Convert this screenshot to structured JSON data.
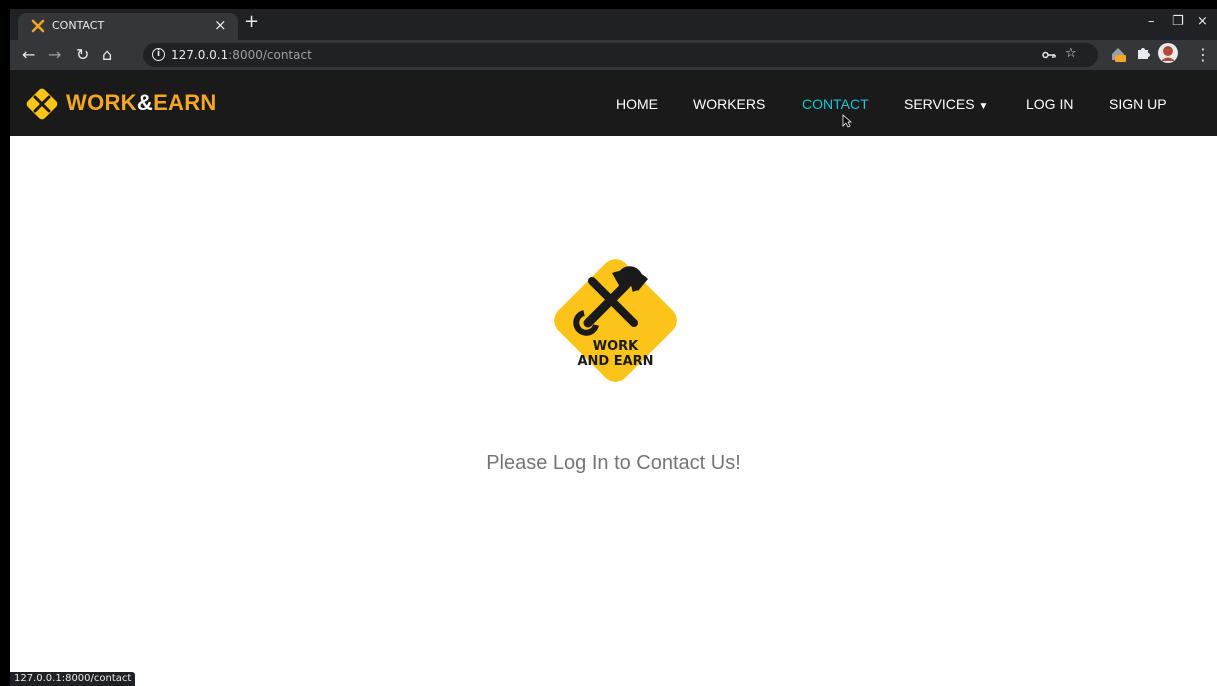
{
  "browser": {
    "tab": {
      "title": "CONTACT",
      "close": "×"
    },
    "new_tab": "+",
    "window_controls": {
      "minimize": "–",
      "restore": "❐",
      "close": "×"
    },
    "address_bar": {
      "host": "127.0.0.1",
      "path": ":8000/contact"
    },
    "status_url": "127.0.0.1:8000/contact",
    "icons": [
      "back-icon",
      "forward-icon",
      "reload-icon",
      "home-icon",
      "info-icon",
      "key-icon",
      "star-icon",
      "extension-off-icon",
      "puzzle-icon",
      "profile-avatar",
      "more-menu-icon"
    ]
  },
  "site": {
    "brand": {
      "work": "WORK",
      "amp": "&",
      "earn": "EARN"
    },
    "nav": {
      "home": "HOME",
      "workers": "WORKERS",
      "contact": "CONTACT",
      "services": "SERVICES",
      "login": "LOG IN",
      "signup": "SIGN UP"
    },
    "logo_text": {
      "line1": "WORK",
      "line2": "AND EARN"
    },
    "message": "Please Log In to Contact Us!",
    "colors": {
      "accent": "#f5a623",
      "active_link": "#16c4d6",
      "logo_yellow": "#fcc419",
      "nav_bg": "#1a1a1a"
    }
  }
}
